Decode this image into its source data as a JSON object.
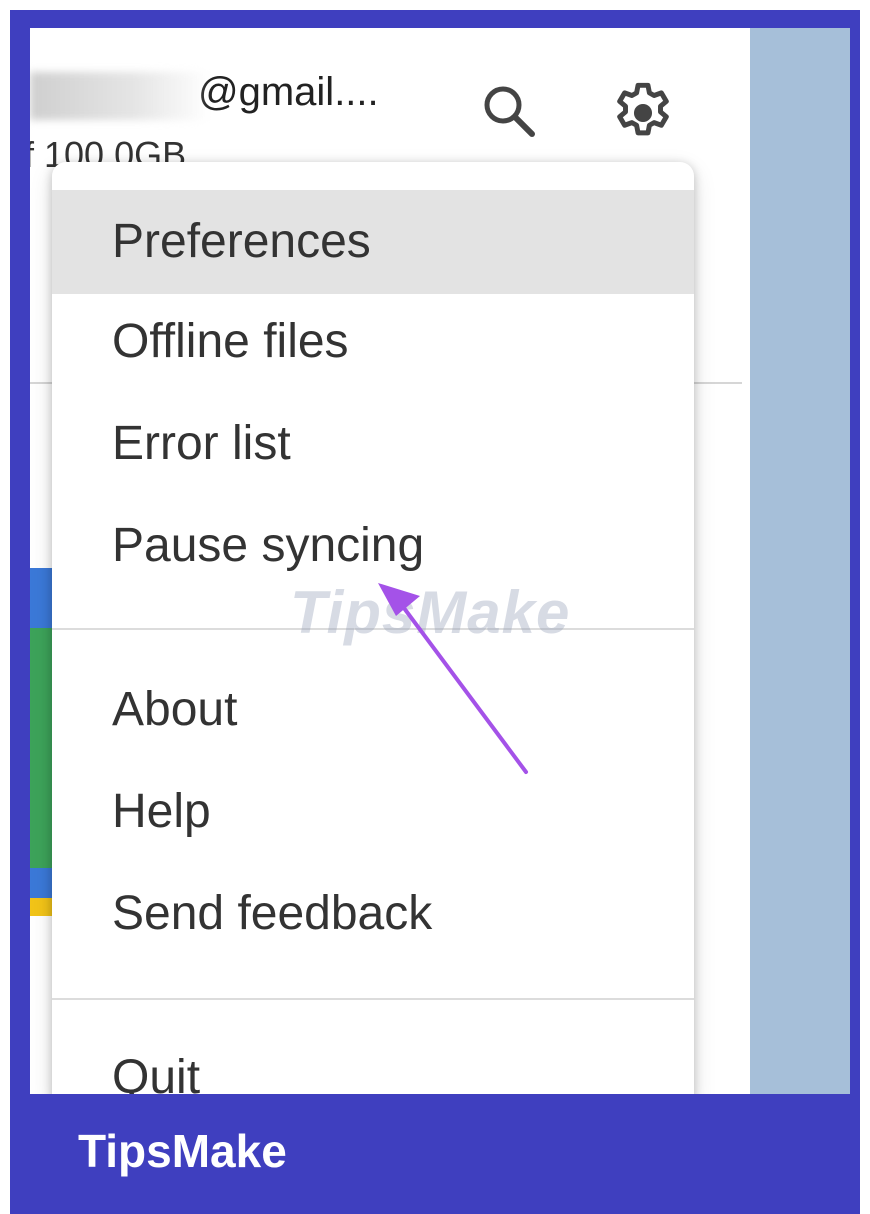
{
  "account": {
    "email_fragment": "@gmail....",
    "storage_fragment": "f 100.0GB"
  },
  "toolbar": {
    "search_icon": "search-icon",
    "settings_icon": "gear-icon"
  },
  "menu": {
    "items": [
      {
        "label": "Preferences",
        "active": true
      },
      {
        "label": "Offline files"
      },
      {
        "label": "Error list"
      },
      {
        "label": "Pause syncing"
      },
      {
        "label": "About"
      },
      {
        "label": "Help"
      },
      {
        "label": "Send feedback"
      },
      {
        "label": "Quit"
      }
    ]
  },
  "watermark": {
    "text": "TipsMake"
  },
  "footer": {
    "brand": "TipsMake"
  },
  "colors": {
    "frame_border": "#3f3fbf",
    "side_panel": "#a6bfd9",
    "menu_highlight": "#e3e3e3",
    "arrow": "#a452e8"
  }
}
